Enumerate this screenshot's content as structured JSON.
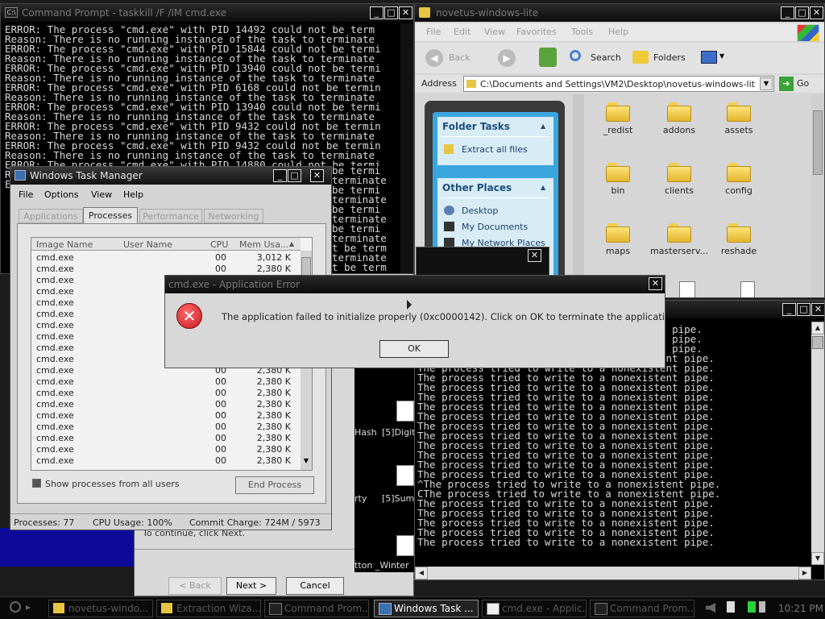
{
  "cmd_top": {
    "title": "Command Prompt - taskkill /F /IM cmd.exe",
    "lines": [
      "ERROR: The process \"cmd.exe\" with PID 14492 could not be term",
      "Reason: There is no running instance of the task to terminate",
      "ERROR: The process \"cmd.exe\" with PID 15844 could not be termi",
      "Reason: There is no running instance of the task to terminate",
      "ERROR: The process \"cmd.exe\" with PID 13940 could not be termi",
      "Reason: There is no running instance of the task to terminate",
      "ERROR: The process \"cmd.exe\" with PID 6168 could not be termin",
      "Reason: There is no running instance of the task to terminate",
      "ERROR: The process \"cmd.exe\" with PID 13940 could not be termi",
      "Reason: There is no running instance of the task to terminate",
      "ERROR: The process \"cmd.exe\" with PID 9432 could not be termin",
      "Reason: There is no running instance of the task to terminate",
      "ERROR: The process \"cmd.exe\" with PID 9432 could not be termin",
      "Reason: There is no running instance of the task to terminate",
      "ERROR: The process \"cmd.exe\" with PID 14880 could not be termi",
      "Reason: There is no running instance of the task to terminate",
      "ERROR: The process \"cmd.exe\" with PID 15472 could not be termi"
    ],
    "right_fragments": [
      "be termi",
      "terminate",
      "be termi",
      "terminate",
      "be termi",
      "terminate",
      "be termi",
      "terminate",
      "t be term",
      "terminate",
      "t be term",
      "terminate"
    ]
  },
  "explorer": {
    "title": "novetus-windows-lite",
    "menu": [
      "File",
      "Edit",
      "View",
      "Favorites",
      "Tools",
      "Help"
    ],
    "back_label": "Back",
    "search_label": "Search",
    "folders_label": "Folders",
    "address_label": "Address",
    "address_value": "C:\\Documents and Settings\\VM2\\Desktop\\novetus-windows-lit",
    "go_label": "Go",
    "folder_tasks_header": "Folder Tasks",
    "extract_label": "Extract all files",
    "other_places_header": "Other Places",
    "places": [
      "Desktop",
      "My Documents",
      "My Network Places"
    ],
    "folders": [
      "_redist",
      "addons",
      "assets",
      "bin",
      "clients",
      "config",
      "maps",
      "masterserv...",
      "reshade"
    ]
  },
  "task_manager": {
    "title": "Windows Task Manager",
    "menu": [
      "File",
      "Options",
      "View",
      "Help"
    ],
    "tabs": [
      "Applications",
      "Processes",
      "Performance",
      "Networking"
    ],
    "columns": [
      "Image Name",
      "User Name",
      "CPU",
      "Mem Usa..."
    ],
    "rows": [
      {
        "name": "cmd.exe",
        "cpu": "00",
        "mem": "3,012 K"
      },
      {
        "name": "cmd.exe",
        "cpu": "00",
        "mem": "2,380 K"
      },
      {
        "name": "cmd.exe",
        "cpu": "",
        "mem": ""
      },
      {
        "name": "cmd.exe",
        "cpu": "",
        "mem": ""
      },
      {
        "name": "cmd.exe",
        "cpu": "",
        "mem": ""
      },
      {
        "name": "cmd.exe",
        "cpu": "",
        "mem": ""
      },
      {
        "name": "cmd.exe",
        "cpu": "",
        "mem": ""
      },
      {
        "name": "cmd.exe",
        "cpu": "",
        "mem": ""
      },
      {
        "name": "cmd.exe",
        "cpu": "",
        "mem": ""
      },
      {
        "name": "cmd.exe",
        "cpu": "",
        "mem": ""
      },
      {
        "name": "cmd.exe",
        "cpu": "00",
        "mem": "2,380 K"
      },
      {
        "name": "cmd.exe",
        "cpu": "00",
        "mem": "2,380 K"
      },
      {
        "name": "cmd.exe",
        "cpu": "00",
        "mem": "2,380 K"
      },
      {
        "name": "cmd.exe",
        "cpu": "00",
        "mem": "2,380 K"
      },
      {
        "name": "cmd.exe",
        "cpu": "00",
        "mem": "2,380 K"
      },
      {
        "name": "cmd.exe",
        "cpu": "00",
        "mem": "2,380 K"
      },
      {
        "name": "cmd.exe",
        "cpu": "00",
        "mem": "2,380 K"
      },
      {
        "name": "cmd.exe",
        "cpu": "00",
        "mem": "2,380 K"
      },
      {
        "name": "cmd.exe",
        "cpu": "00",
        "mem": "2,380 K"
      }
    ],
    "show_all_label": "Show processes from all users",
    "end_process_label": "End Process",
    "status_processes": "Processes: 77",
    "status_cpu": "CPU Usage: 100%",
    "status_commit": "Commit Charge: 724M / 5973"
  },
  "error_dialog": {
    "title": "cmd.exe - Application Error",
    "message": "The application failed to initialize properly (0xc0000142). Click on OK to terminate the application.",
    "ok_label": "OK"
  },
  "cmd_bottom": {
    "lines": [
      "                                  xistent pipe.",
      "                                  xistent pipe.",
      "                                  xistent pipe.",
      "The process tried to write to a nonexistent pipe.",
      "The process tried to write to a nonexistent pipe.",
      "The process tried to write to a nonexistent pipe.",
      "The process tried to write to a nonexistent pipe.",
      "The process tried to write to a nonexistent pipe.",
      "The process tried to write to a nonexistent pipe.",
      "The process tried to write to a nonexistent pipe.",
      "The process tried to write to a nonexistent pipe.",
      "The process tried to write to a nonexistent pipe.",
      "The process tried to write to a nonexistent pipe.",
      "The process tried to write to a nonexistent pipe.",
      "The process tried to write to a nonexistent pipe.",
      "The process tried to write to a nonexistent pipe.",
      "^The process tried to write to a nonexistent pipe.",
      "CThe process tried to write to a nonexistent pipe.",
      "The process tried to write to a nonexistent pipe.",
      "The process tried to write to a nonexistent pipe.",
      "The process tried to write to a nonexistent pipe.",
      "The process tried to write to a nonexistent pipe.",
      "The process tried to write to a nonexistent pipe."
    ]
  },
  "wizard": {
    "continue_text": "To continue, click Next.",
    "back_label": "< Back",
    "next_label": "Next >",
    "cancel_label": "Cancel"
  },
  "desktop": {
    "icon_labels": [
      "Hash",
      "[5]Digit",
      "rty",
      "[5]Sum",
      "tton _Winter"
    ]
  },
  "taskbar": {
    "items": [
      "novetus-windo...",
      "Extraction Wiza...",
      "Command Prom...",
      "Windows Task ...",
      "cmd.exe - Applic...",
      "Command Prom..."
    ],
    "clock": "10:21 PM"
  },
  "colors": {
    "desktop_blue": "#0d0a9a",
    "error_red": "#d7262c",
    "explorer_blue": "#3aa6df"
  }
}
